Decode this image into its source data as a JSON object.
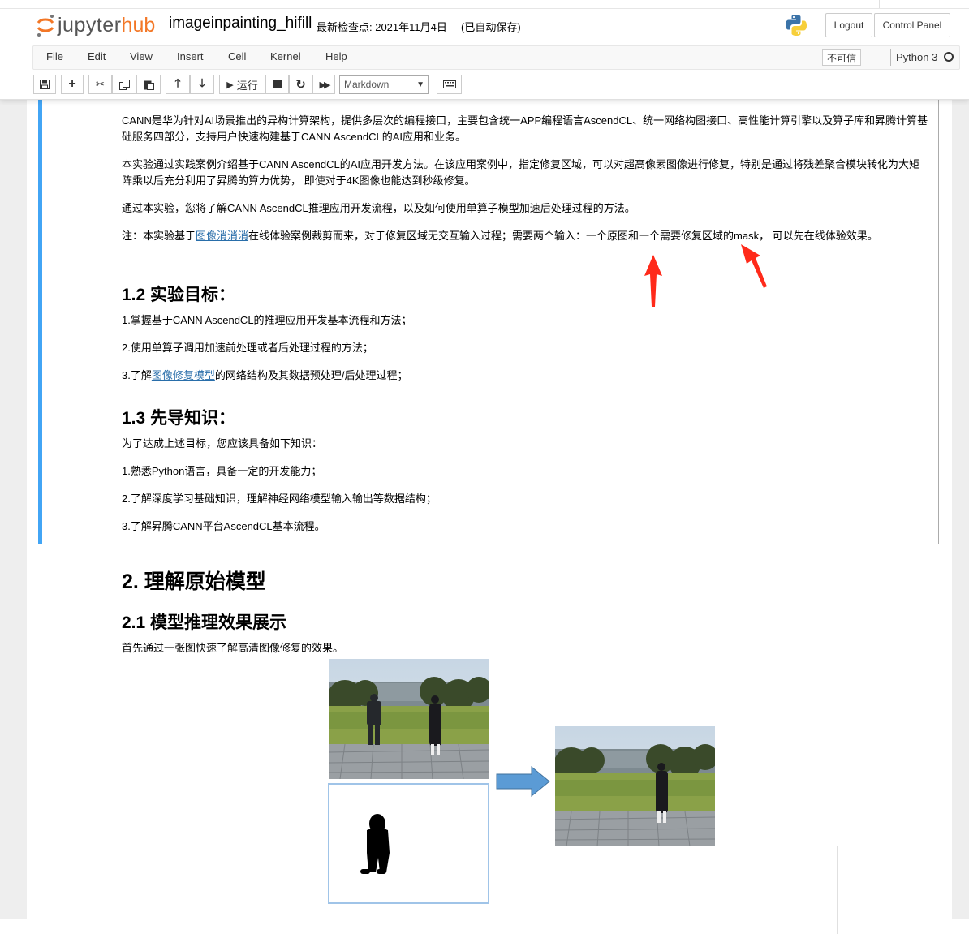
{
  "header": {
    "logo_j": "jupyter",
    "logo_hub": "hub",
    "notebook_name": "imageinpainting_hifill",
    "checkpoint": "最新检查点: 2021年11月4日",
    "autosave": "(已自动保存)",
    "logout_label": "Logout",
    "control_panel_label": "Control Panel"
  },
  "menubar": {
    "items": [
      "File",
      "Edit",
      "View",
      "Insert",
      "Cell",
      "Kernel",
      "Help"
    ],
    "trusted_label": "不可信",
    "kernel_name": "Python 3"
  },
  "toolbar": {
    "run_label": "运行",
    "cell_type": "Markdown"
  },
  "content": {
    "p1": "CANN是华为针对AI场景推出的异构计算架构，提供多层次的编程接口，主要包含统一APP编程语言AscendCL、统一网络构图接口、高性能计算引擎以及算子库和昇腾计算基础服务四部分，支持用户快速构建基于CANN AscendCL的AI应用和业务。",
    "p2": "本实验通过实践案例介绍基于CANN AscendCL的AI应用开发方法。在该应用案例中，指定修复区域，可以对超高像素图像进行修复，特别是通过将残差聚合模块转化为大矩阵乘以后充分利用了昇腾的算力优势， 即使对于4K图像也能达到秒级修复。",
    "p3": "通过本实验，您将了解CANN AscendCL推理应用开发流程，以及如何使用单算子模型加速后处理过程的方法。",
    "p4_pre": "注：本实验基于",
    "p4_link": "图像消消消",
    "p4_post": "在线体验案例裁剪而来，对于修复区域无交互输入过程；需要两个输入：一个原图和一个需要修复区域的mask， 可以先在线体验效果。",
    "h_1_2": "1.2 实验目标：",
    "goal1": "1.掌握基于CANN AscendCL的推理应用开发基本流程和方法；",
    "goal2": "2.使用单算子调用加速前处理或者后处理过程的方法；",
    "goal3_pre": "3.了解",
    "goal3_link": "图像修复模型",
    "goal3_post": "的网络结构及其数据预处理/后处理过程；",
    "h_1_3": "1.3 先导知识：",
    "pre_intro": "为了达成上述目标，您应该具备如下知识：",
    "pre1": "1.熟悉Python语言，具备一定的开发能力；",
    "pre2": "2.了解深度学习基础知识，理解神经网络模型输入输出等数据结构；",
    "pre3": "3.了解昇腾CANN平台AscendCL基本流程。",
    "h_2": "2. 理解原始模型",
    "h_2_1": "2.1 模型推理效果展示",
    "p_fig": "首先通过一张图快速了解高清图像修复的效果。"
  },
  "colors": {
    "accent_blue": "#42a5f5",
    "jupyter_orange": "#f37726",
    "annotation_red": "#ff2a1a"
  }
}
